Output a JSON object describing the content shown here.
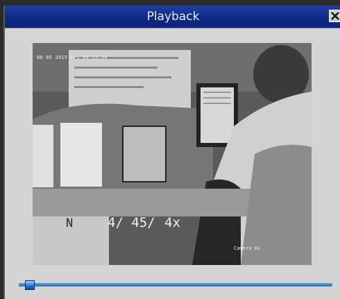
{
  "window": {
    "title": "Playback",
    "close_icon": "close-icon"
  },
  "video": {
    "datetime": "08 05 2015 Fri 09:15:34",
    "channel_marker": "N",
    "position": "4/ 45/",
    "speed": "4x",
    "camera_label": "Camera 01"
  },
  "progress": {
    "value": 0.02
  },
  "colors": {
    "titlebar": "#0f2a86",
    "track": "#2a6fb0",
    "handle": "#2b6fd0"
  }
}
